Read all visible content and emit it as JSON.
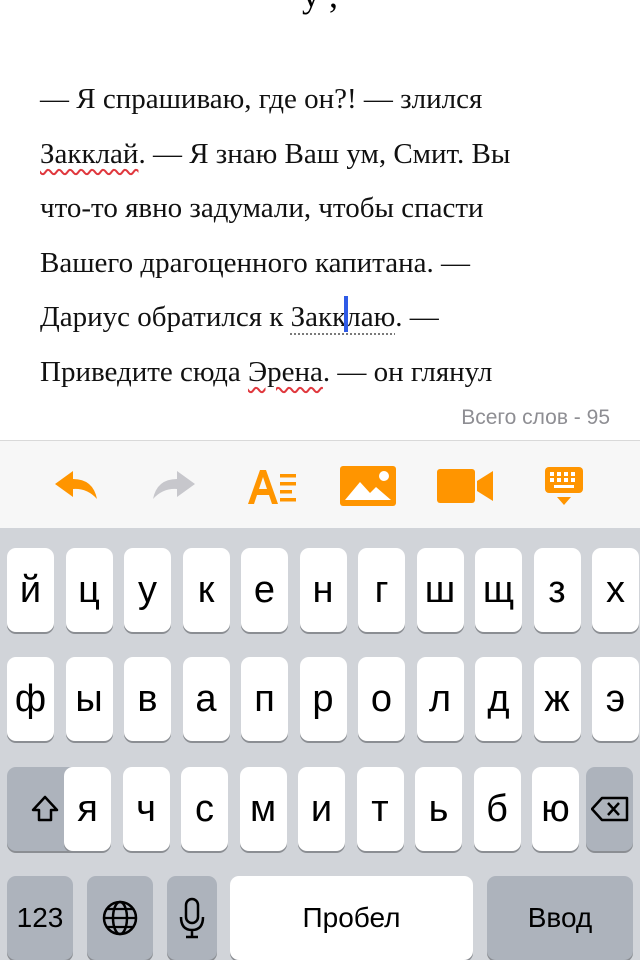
{
  "editor": {
    "cut_title_fragment": "y ,",
    "lines": [
      {
        "segments": [
          {
            "t": "— Я спрашиваю, где он?! — злился"
          }
        ]
      },
      {
        "segments": [
          {
            "t": "Закклай",
            "spell": true
          },
          {
            "t": ". — Я знаю Ваш ум, Смит. Вы"
          }
        ]
      },
      {
        "segments": [
          {
            "t": "что-то явно задумали, чтобы спасти"
          }
        ]
      },
      {
        "segments": [
          {
            "t": "Вашего драгоценного капитана. —"
          }
        ]
      },
      {
        "segments": [
          {
            "t": "Дариус обратился к "
          },
          {
            "t": "Закк",
            "grey": true
          },
          {
            "caret": true
          },
          {
            "t": "лаю",
            "grey": true
          },
          {
            "t": ". —"
          }
        ]
      },
      {
        "segments": [
          {
            "t": "Приведите сюда "
          },
          {
            "t": "Эрена",
            "spell": true
          },
          {
            "t": ". — он глянул"
          }
        ]
      }
    ],
    "word_count_label": "Всего слов - 95"
  },
  "toolbar": {
    "accent_color": "#ff9500",
    "disabled_color": "#c7c7cc",
    "buttons": [
      {
        "name": "undo-button",
        "icon": "undo-arrow-icon",
        "enabled": true
      },
      {
        "name": "redo-button",
        "icon": "redo-arrow-icon",
        "enabled": false
      },
      {
        "name": "text-format-button",
        "icon": "text-format-icon",
        "enabled": true
      },
      {
        "name": "insert-image-button",
        "icon": "image-icon",
        "enabled": true
      },
      {
        "name": "insert-video-button",
        "icon": "video-camera-icon",
        "enabled": true
      },
      {
        "name": "hide-keyboard-button",
        "icon": "keyboard-hide-icon",
        "enabled": true
      }
    ]
  },
  "keyboard": {
    "row1": [
      "й",
      "ц",
      "у",
      "к",
      "е",
      "н",
      "г",
      "ш",
      "щ",
      "з",
      "х"
    ],
    "row2": [
      "ф",
      "ы",
      "в",
      "а",
      "п",
      "р",
      "о",
      "л",
      "д",
      "ж",
      "э"
    ],
    "row3": [
      "я",
      "ч",
      "с",
      "м",
      "и",
      "т",
      "ь",
      "б",
      "ю"
    ],
    "numbers_label": "123",
    "space_label": "Пробел",
    "return_label": "Ввод",
    "shift_icon": "shift-icon",
    "delete_icon": "delete-backspace-icon",
    "globe_icon": "globe-icon",
    "mic_icon": "microphone-icon"
  }
}
